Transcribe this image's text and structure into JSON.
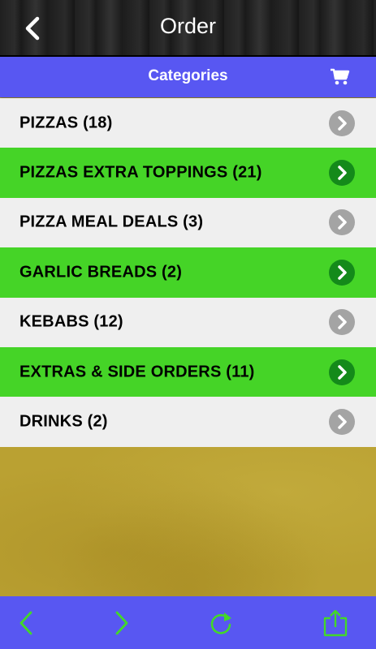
{
  "header": {
    "title": "Order",
    "back_icon": "chevron-left-icon"
  },
  "category_bar": {
    "label": "Categories",
    "cart_icon": "cart-icon"
  },
  "categories": [
    {
      "label": "PIZZAS (18)",
      "style": "white"
    },
    {
      "label": "PIZZAS EXTRA TOPPINGS (21)",
      "style": "green"
    },
    {
      "label": "PIZZA MEAL DEALS (3)",
      "style": "white"
    },
    {
      "label": "GARLIC BREADS (2)",
      "style": "green"
    },
    {
      "label": "KEBABS (12)",
      "style": "white"
    },
    {
      "label": "EXTRAS & SIDE ORDERS (11)",
      "style": "green"
    },
    {
      "label": "DRINKS (2)",
      "style": "white"
    }
  ],
  "footer": {
    "icons": [
      "back-arrow-icon",
      "forward-arrow-icon",
      "refresh-icon",
      "share-icon"
    ]
  },
  "colors": {
    "accent_blue": "#5857f2",
    "row_green": "#45d427",
    "row_white": "#efefef",
    "icon_green": "#43d829"
  }
}
